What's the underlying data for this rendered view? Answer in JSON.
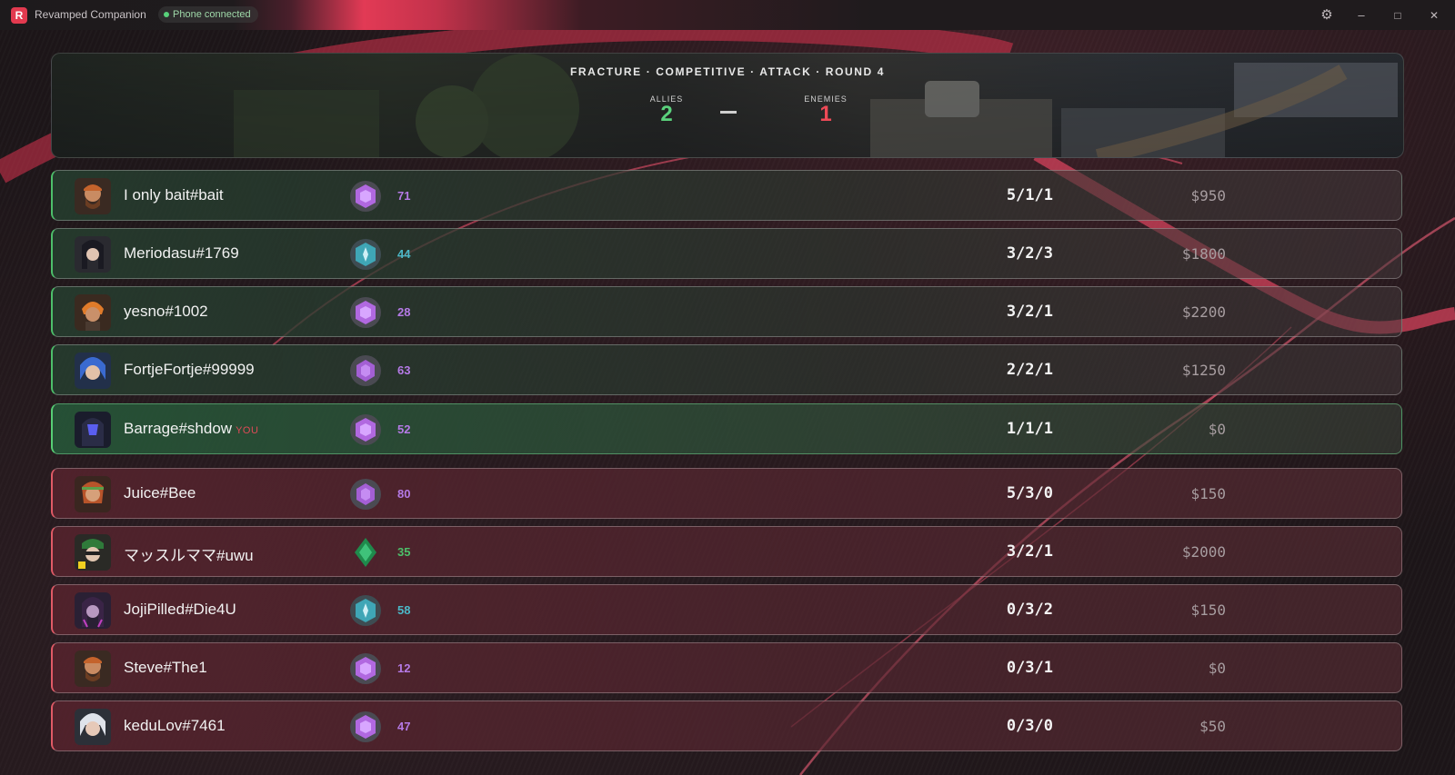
{
  "app": {
    "title": "Revamped Companion",
    "logo_letter": "R",
    "status": "Phone connected"
  },
  "window_controls": {
    "settings": "⚙",
    "minimize": "–",
    "maximize": "□",
    "close": "✕"
  },
  "match": {
    "title": "FRACTURE · COMPETITIVE · ATTACK · ROUND 4",
    "allies_label": "ALLIES",
    "allies_score": "2",
    "enemies_label": "ENEMIES",
    "enemies_score": "1"
  },
  "colors": {
    "ally_accent": "#4dbf6a",
    "enemy_accent": "#e05a66",
    "allies_score": "#5ad17c",
    "enemies_score": "#ef4a57",
    "brand": "#e23a4f"
  },
  "players": [
    {
      "team": "ally",
      "name": "I only bait#bait",
      "rank": "purple",
      "level": "71",
      "kda": "5/1/1",
      "money": "$950",
      "you": ""
    },
    {
      "team": "ally",
      "name": "Meriodasu#1769",
      "rank": "teal",
      "level": "44",
      "kda": "3/2/3",
      "money": "$1800",
      "you": ""
    },
    {
      "team": "ally",
      "name": "yesno#1002",
      "rank": "purple",
      "level": "28",
      "kda": "3/2/1",
      "money": "$2200",
      "you": ""
    },
    {
      "team": "ally",
      "name": "FortjeFortje#99999",
      "rank": "purple-plain",
      "level": "63",
      "kda": "2/2/1",
      "money": "$1250",
      "you": ""
    },
    {
      "team": "ally",
      "name": "Barrage#shdow",
      "rank": "purple",
      "level": "52",
      "kda": "1/1/1",
      "money": "$0",
      "you": "YOU"
    },
    {
      "team": "enemy",
      "name": "Juice#Bee",
      "rank": "purple-plain",
      "level": "80",
      "kda": "5/3/0",
      "money": "$150",
      "you": ""
    },
    {
      "team": "enemy",
      "name": "マッスルママ#uwu",
      "rank": "green",
      "level": "35",
      "kda": "3/2/1",
      "money": "$2000",
      "you": ""
    },
    {
      "team": "enemy",
      "name": "JojiPilled#Die4U",
      "rank": "teal",
      "level": "58",
      "kda": "0/3/2",
      "money": "$150",
      "you": ""
    },
    {
      "team": "enemy",
      "name": "Steve#The1",
      "rank": "purple",
      "level": "12",
      "kda": "0/3/1",
      "money": "$0",
      "you": ""
    },
    {
      "team": "enemy",
      "name": "keduLov#7461",
      "rank": "purple",
      "level": "47",
      "kda": "0/3/0",
      "money": "$50",
      "you": ""
    }
  ]
}
